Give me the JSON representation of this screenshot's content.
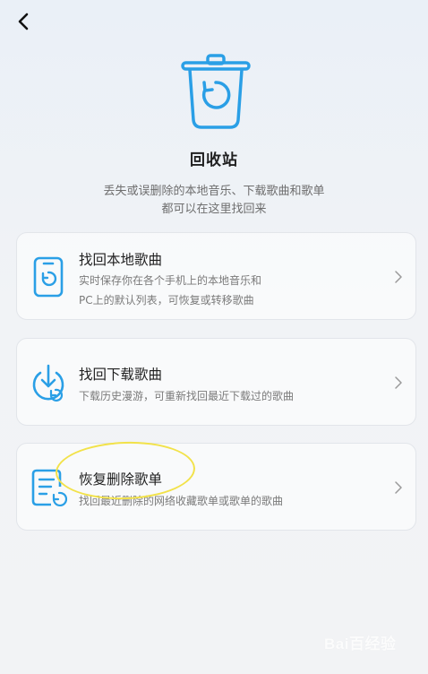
{
  "header": {
    "back_icon": "chevron-left-icon"
  },
  "hero": {
    "icon": "recycle-bin-icon",
    "title": "回收站"
  },
  "subtitle": {
    "line1": "丢失或误删除的本地音乐、下载歌曲和歌单",
    "line2": "都可以在这里找回来"
  },
  "cards": [
    {
      "icon": "phone-restore-icon",
      "title": "找回本地歌曲",
      "desc_line1": "实时保存你在各个手机上的本地音乐和",
      "desc_line2": "PC上的默认列表，可恢复或转移歌曲"
    },
    {
      "icon": "download-restore-icon",
      "title": "找回下载歌曲",
      "desc_line1": "下载历史漫游，可重新找回最近下载过的歌曲"
    },
    {
      "icon": "playlist-restore-icon",
      "title": "恢复删除歌单",
      "desc_line1": "找回最近删除的网络收藏歌单或歌单的歌曲"
    }
  ],
  "colors": {
    "accent": "#2a9fe6",
    "highlight": "#f2e24a"
  },
  "watermark": "Bai百经验"
}
